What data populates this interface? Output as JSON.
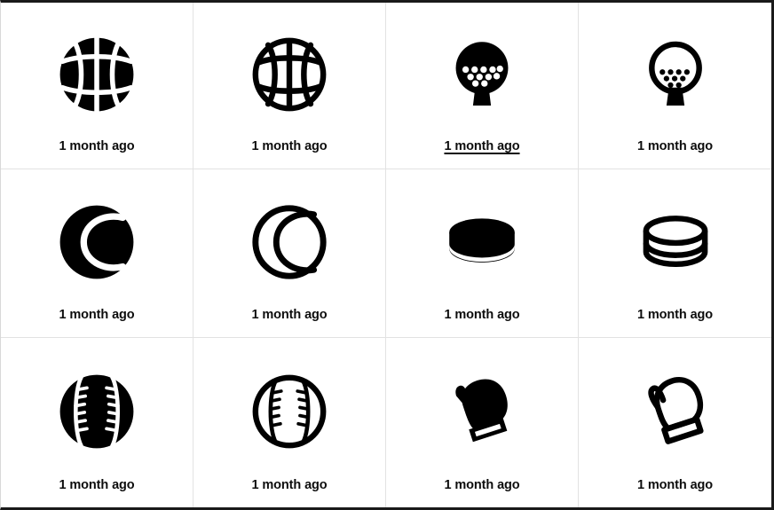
{
  "page": {
    "title": "Sports icon grid",
    "columns": 4,
    "rows": 3,
    "background_color": "#ffffff",
    "grid_line_color": "#e2e2e2",
    "icon_color": "#000000",
    "label_color": "#0d0d0d",
    "outer_border_color": "#1a1a1a"
  },
  "cards": [
    {
      "id": "basketball-filled",
      "icon": "basketball-filled-icon",
      "label": "1 month ago",
      "underlined": false
    },
    {
      "id": "basketball-outline",
      "icon": "basketball-outline-icon",
      "label": "1 month ago",
      "underlined": false
    },
    {
      "id": "golf-ball-filled",
      "icon": "golf-ball-tee-filled-icon",
      "label": "1 month ago",
      "underlined": true
    },
    {
      "id": "golf-ball-outline",
      "icon": "golf-ball-tee-outline-icon",
      "label": "1 month ago",
      "underlined": false
    },
    {
      "id": "tennis-ball-filled",
      "icon": "tennis-ball-filled-icon",
      "label": "1 month ago",
      "underlined": false
    },
    {
      "id": "tennis-ball-outline",
      "icon": "tennis-ball-outline-icon",
      "label": "1 month ago",
      "underlined": false
    },
    {
      "id": "hockey-puck-filled",
      "icon": "hockey-puck-filled-icon",
      "label": "1 month ago",
      "underlined": false
    },
    {
      "id": "hockey-puck-outline",
      "icon": "hockey-puck-outline-icon",
      "label": "1 month ago",
      "underlined": false
    },
    {
      "id": "baseball-filled",
      "icon": "baseball-filled-icon",
      "label": "1 month ago",
      "underlined": false
    },
    {
      "id": "baseball-outline",
      "icon": "baseball-outline-icon",
      "label": "1 month ago",
      "underlined": false
    },
    {
      "id": "boxing-glove-filled",
      "icon": "boxing-glove-filled-icon",
      "label": "1 month ago",
      "underlined": false
    },
    {
      "id": "boxing-glove-outline",
      "icon": "boxing-glove-outline-icon",
      "label": "1 month ago",
      "underlined": false
    }
  ]
}
